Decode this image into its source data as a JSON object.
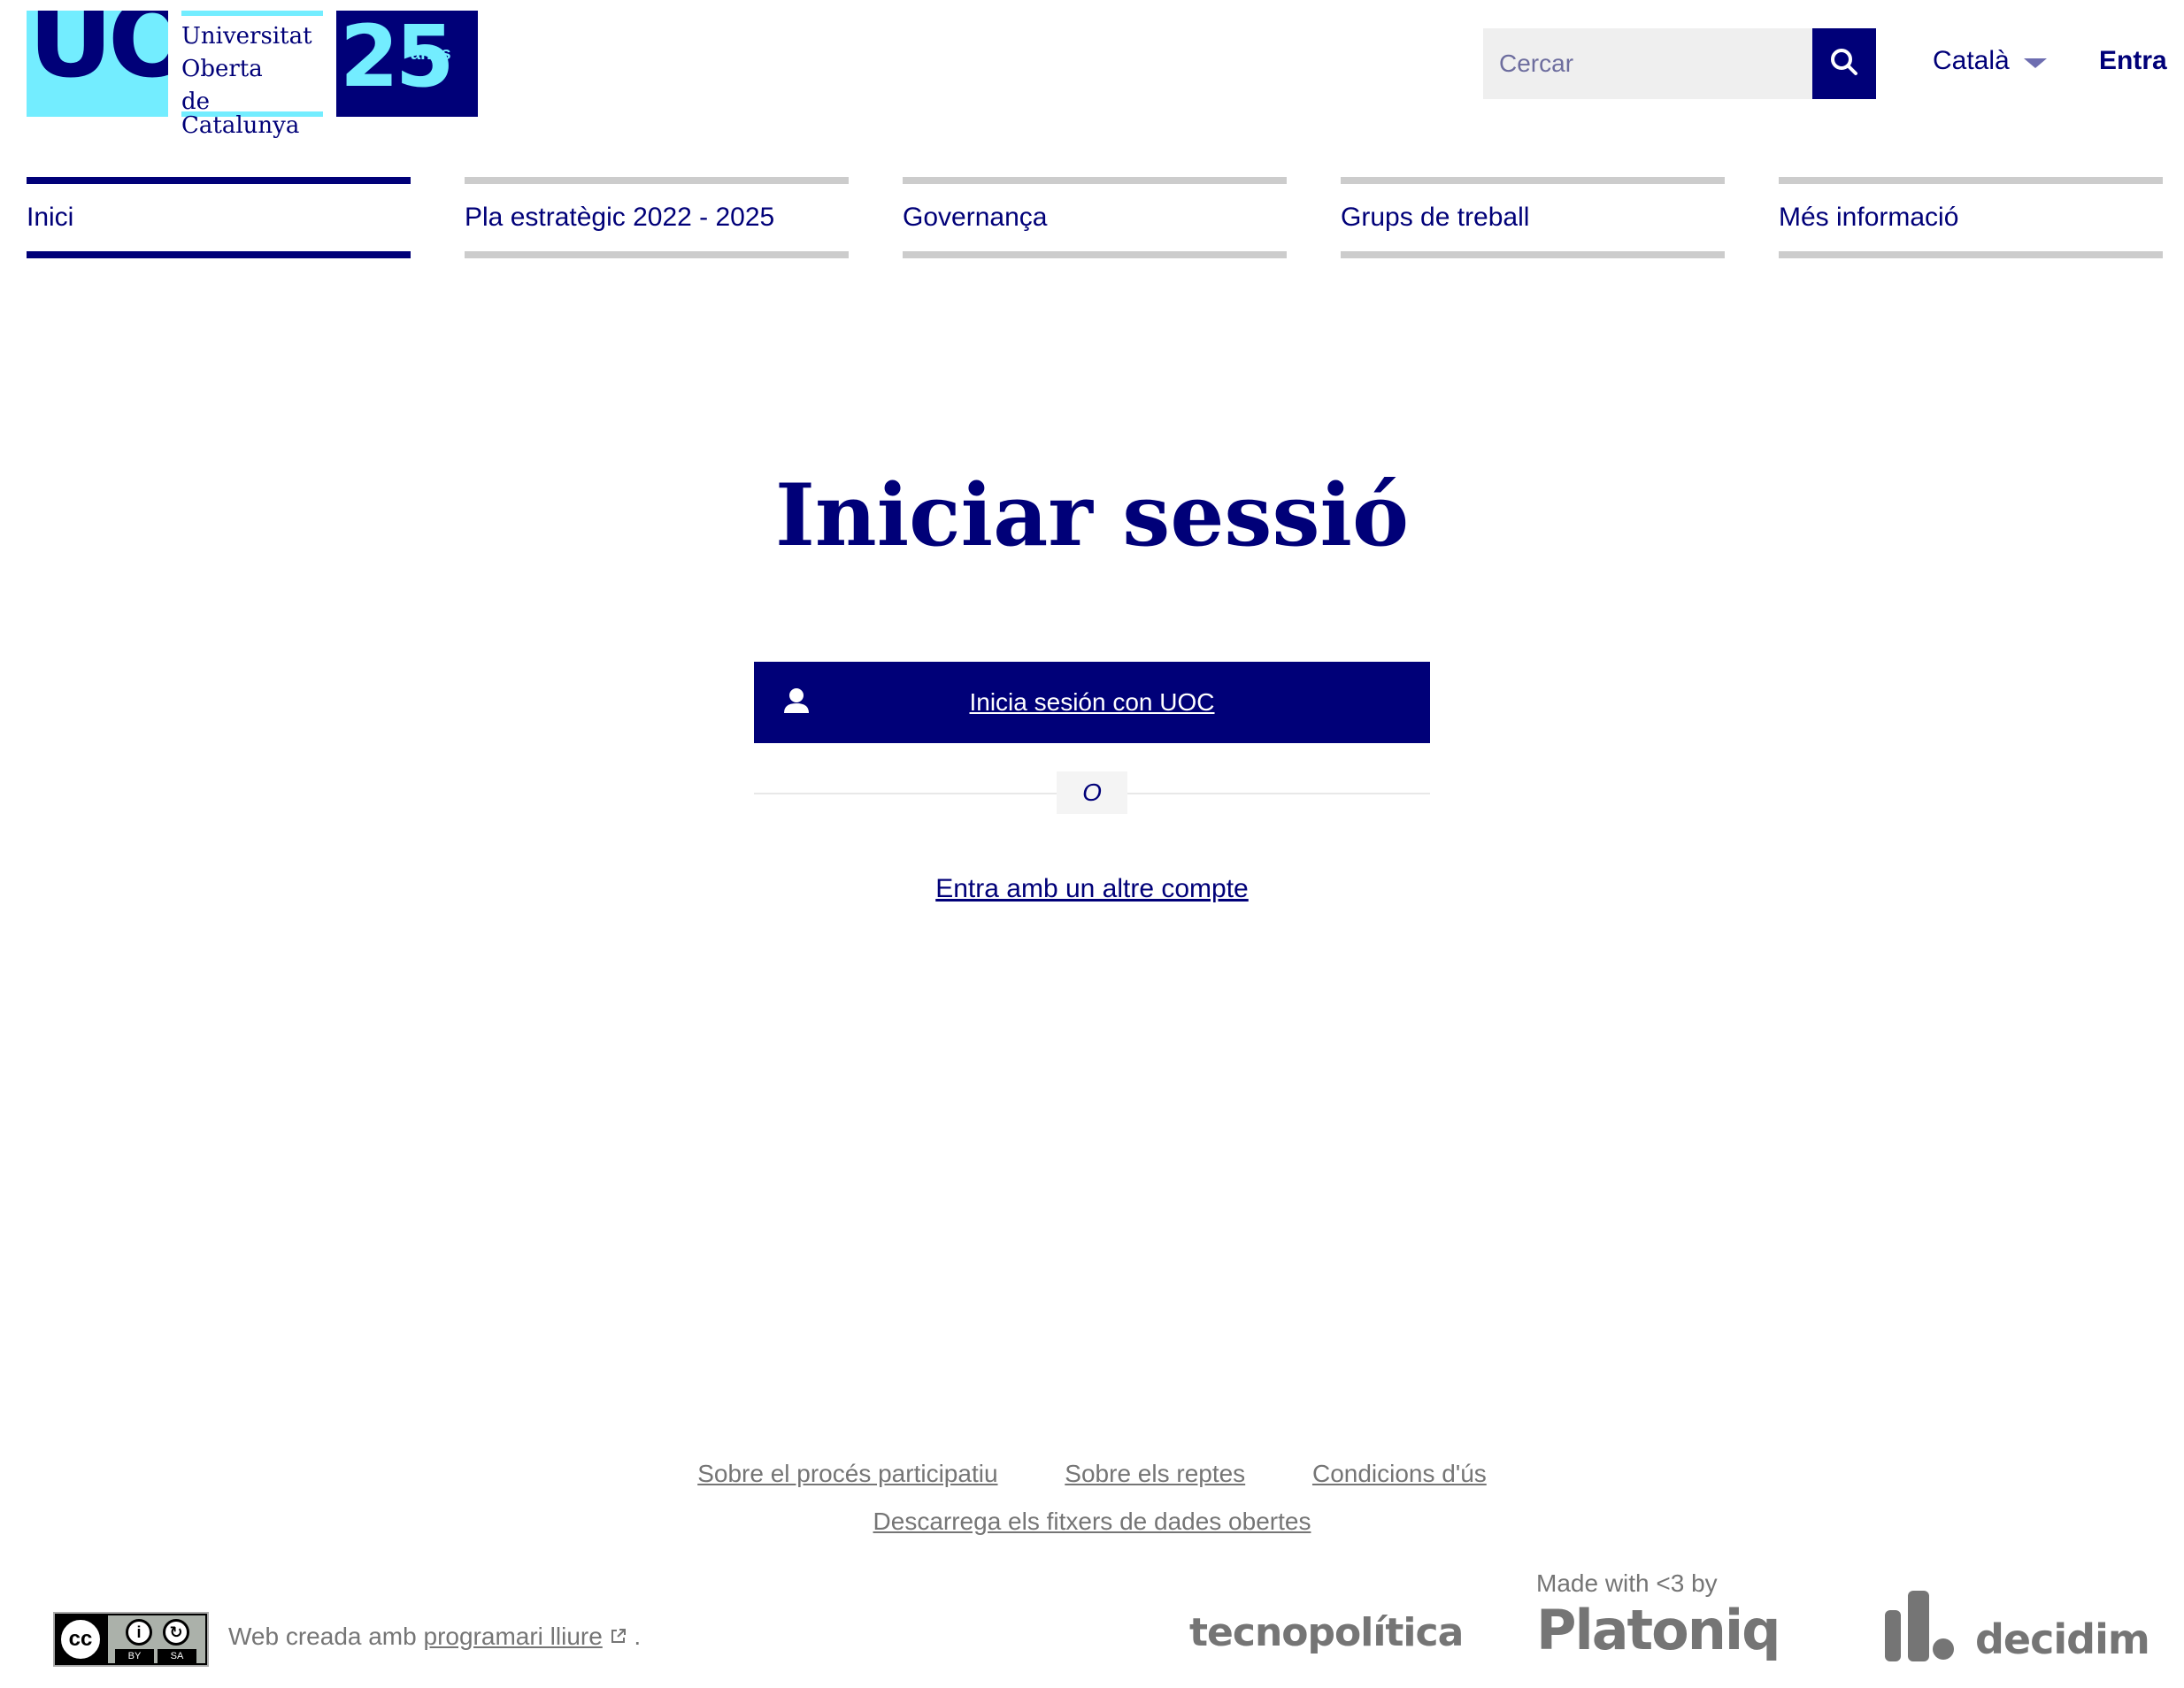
{
  "header": {
    "logo": {
      "mark": "UOC",
      "name_lines": [
        "Universitat",
        "Oberta",
        "de Catalunya"
      ],
      "anniversary_number": "25",
      "anniversary_word": "anys"
    },
    "search": {
      "placeholder": "Cercar",
      "value": "",
      "icon": "search-icon"
    },
    "language": {
      "label": "Català",
      "icon": "caret-down-icon"
    },
    "sign_in_label": "Entra"
  },
  "nav": {
    "items": [
      {
        "label": "Inici",
        "active": true
      },
      {
        "label": "Pla estratègic 2022 - 2025",
        "active": false
      },
      {
        "label": "Governança",
        "active": false
      },
      {
        "label": "Grups de treball",
        "active": false
      },
      {
        "label": "Més informació",
        "active": false
      }
    ]
  },
  "main": {
    "title": "Iniciar sessió",
    "uoc_login": {
      "label": "Inicia sesión con UOC",
      "icon": "user-icon"
    },
    "separator_text": "O",
    "alt_account_link": "Entra amb un altre compte"
  },
  "footer": {
    "links_row1": [
      "Sobre el procés participatiu",
      "Sobre els reptes",
      "Condicions d'ús"
    ],
    "links_row2": [
      "Descarrega els fitxers de dades obertes"
    ],
    "license": {
      "cc": "cc",
      "by": "BY",
      "sa": "SA"
    },
    "web_created_prefix": "Web creada amb",
    "web_created_link": "programari lliure",
    "web_created_suffix": ".",
    "partner_tecnopolitica": "tecnopolítica",
    "made_with": "Made with <3 by",
    "partner_platoniq": "Platoniq",
    "partner_decidim": "decidim"
  },
  "colors": {
    "brand_navy": "#000078",
    "brand_cyan": "#73edff",
    "footer_gray": "#757575",
    "inactive_tab_border": "#cccccc"
  }
}
